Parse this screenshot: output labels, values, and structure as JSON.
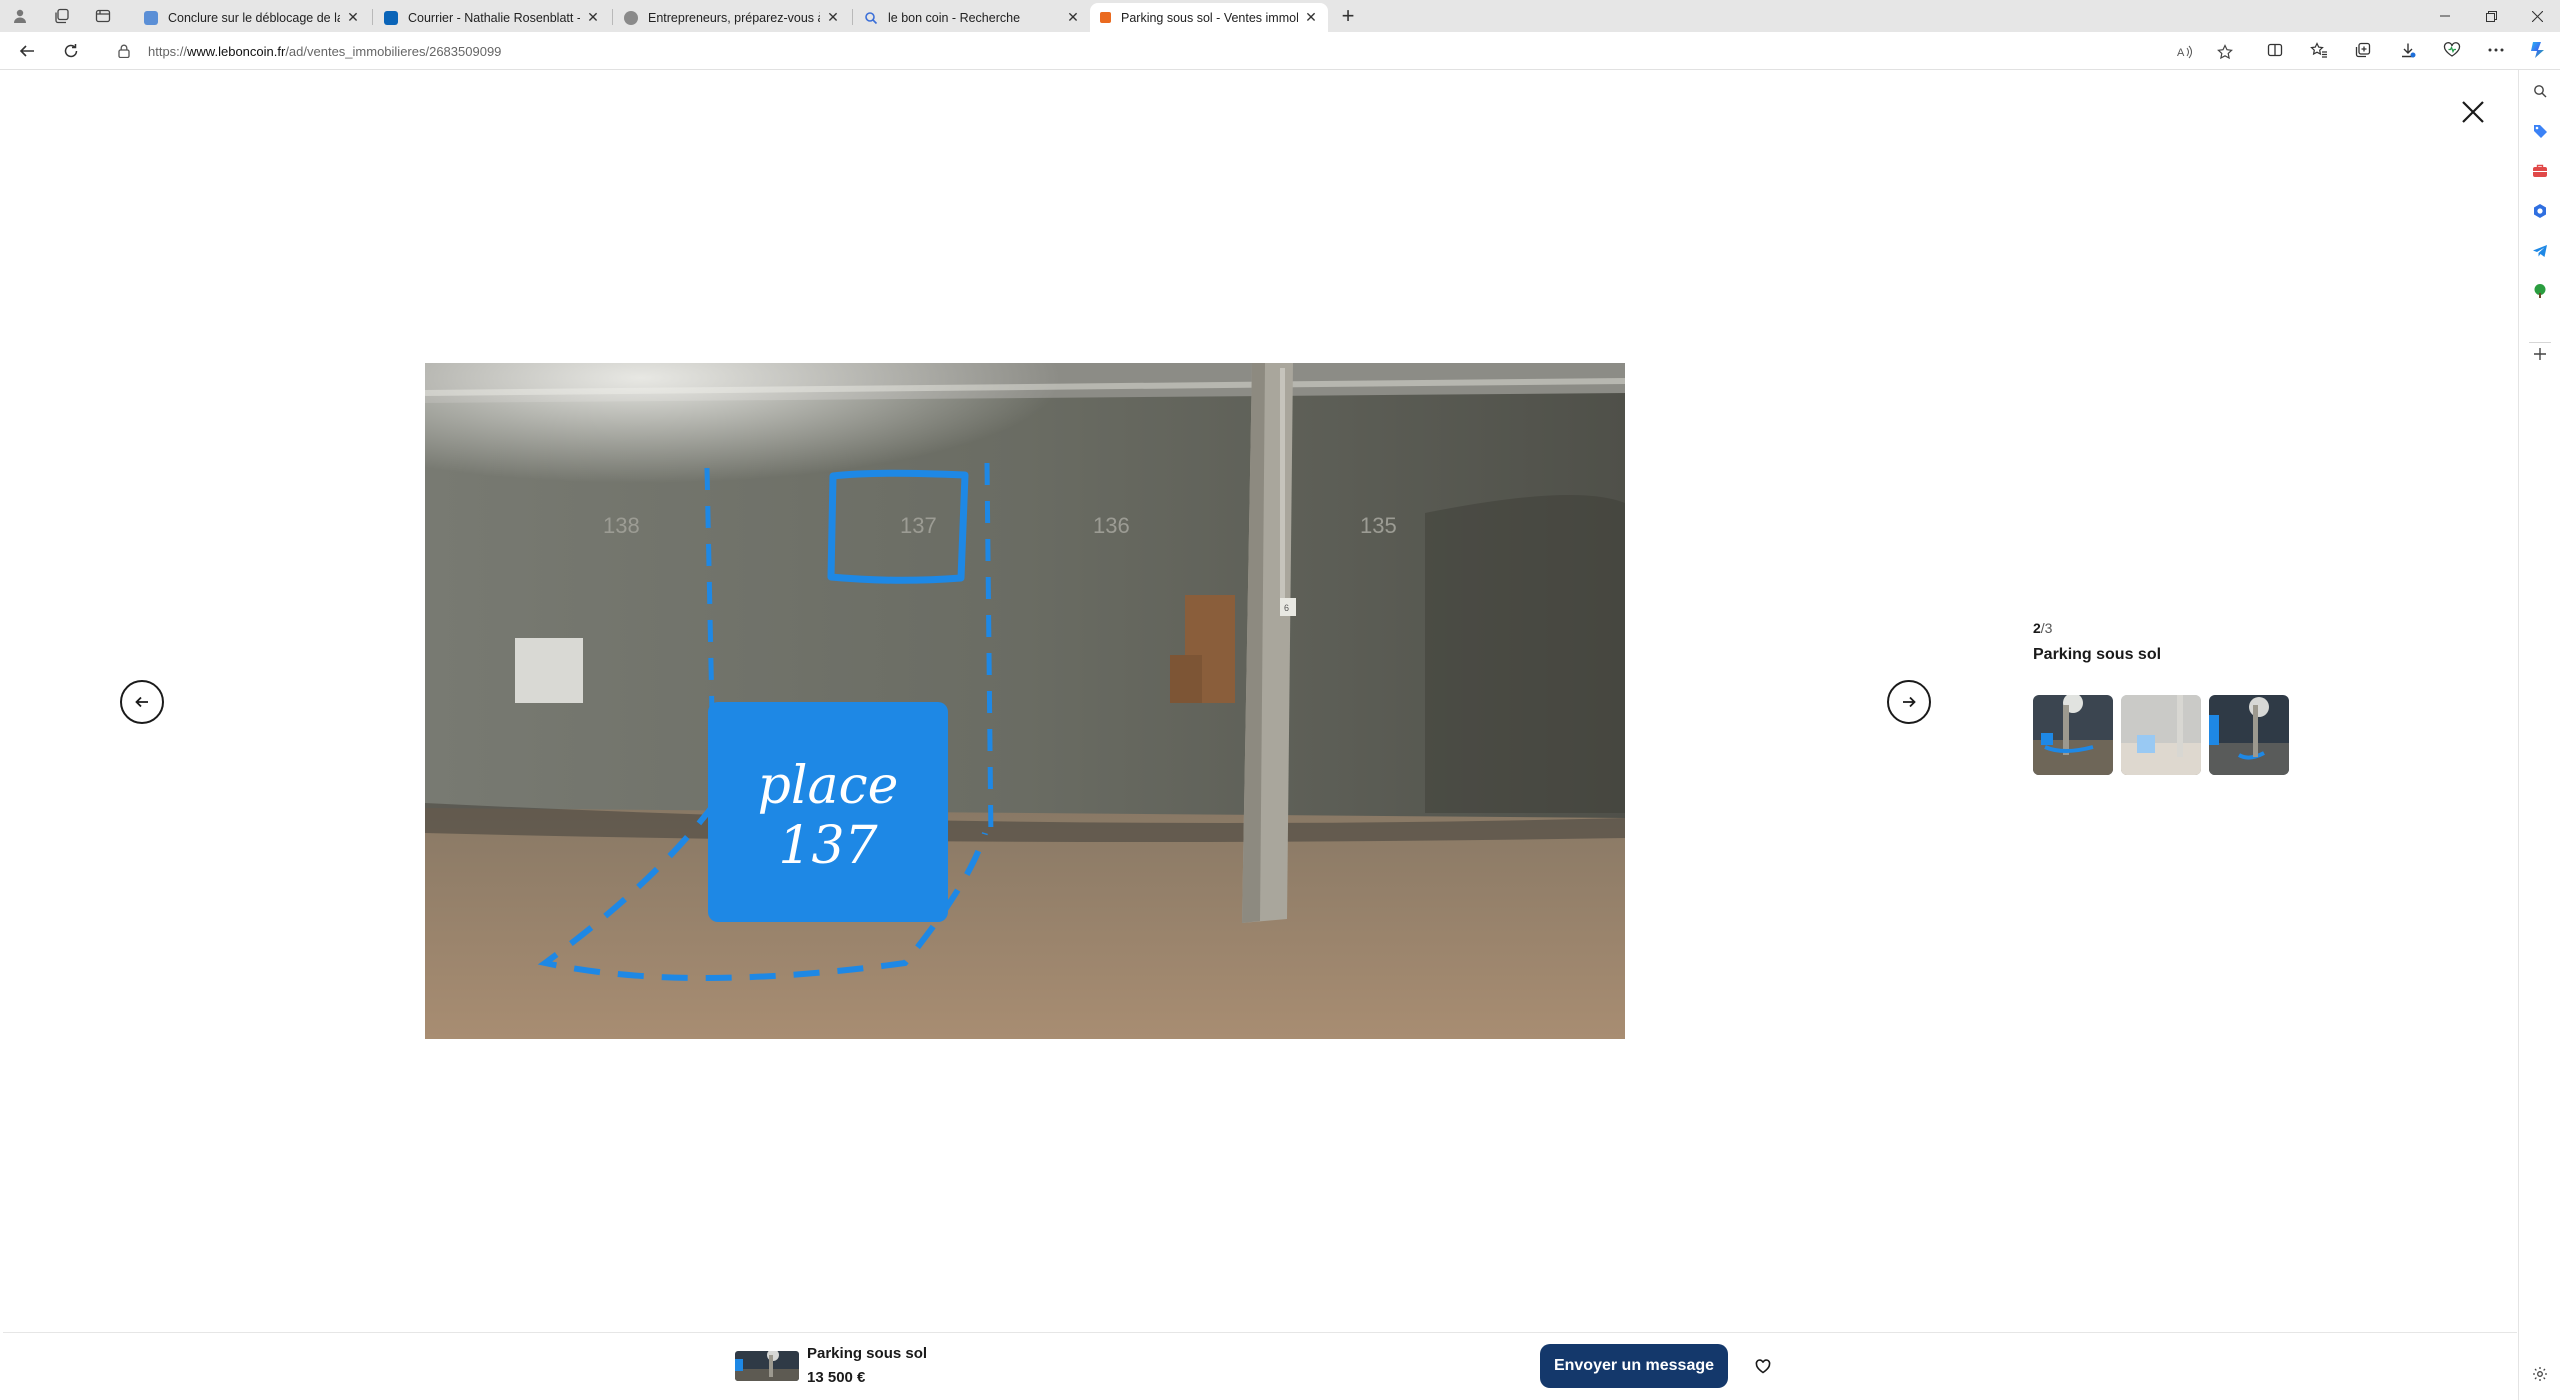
{
  "browser": {
    "tabs": [
      {
        "title": "Conclure sur le déblocage de la",
        "favicon_color": "#5b8fd6",
        "active": false
      },
      {
        "title": "Courrier - Nathalie Rosenblatt - C",
        "favicon_color": "#0a64b8",
        "active": false
      },
      {
        "title": "Entrepreneurs, préparez-vous à l",
        "favicon_color": "#8a8a8a",
        "active": false
      },
      {
        "title": "le bon coin - Recherche",
        "favicon_color": "#3b6fd8",
        "active": false
      },
      {
        "title": "Parking sous sol - Ventes immob",
        "favicon_color": "#ea6a1f",
        "active": true
      }
    ],
    "url_prefix": "https://",
    "url_domain": "www.leboncoin.fr",
    "url_path": "/ad/ventes_immobilieres/2683509099"
  },
  "gallery": {
    "current": "2",
    "total": "/3",
    "title": "Parking sous sol",
    "photo": {
      "overlay_text_line1": "place",
      "overlay_text_line2": "137",
      "wall_numbers": [
        "138",
        "137",
        "136",
        "135"
      ],
      "pillar_label": "6"
    }
  },
  "bottom_bar": {
    "title": "Parking sous sol",
    "price": "13 500 €",
    "message_button": "Envoyer un message"
  },
  "colors": {
    "accent_blue": "#1e88e5",
    "button_navy": "#14386b"
  }
}
